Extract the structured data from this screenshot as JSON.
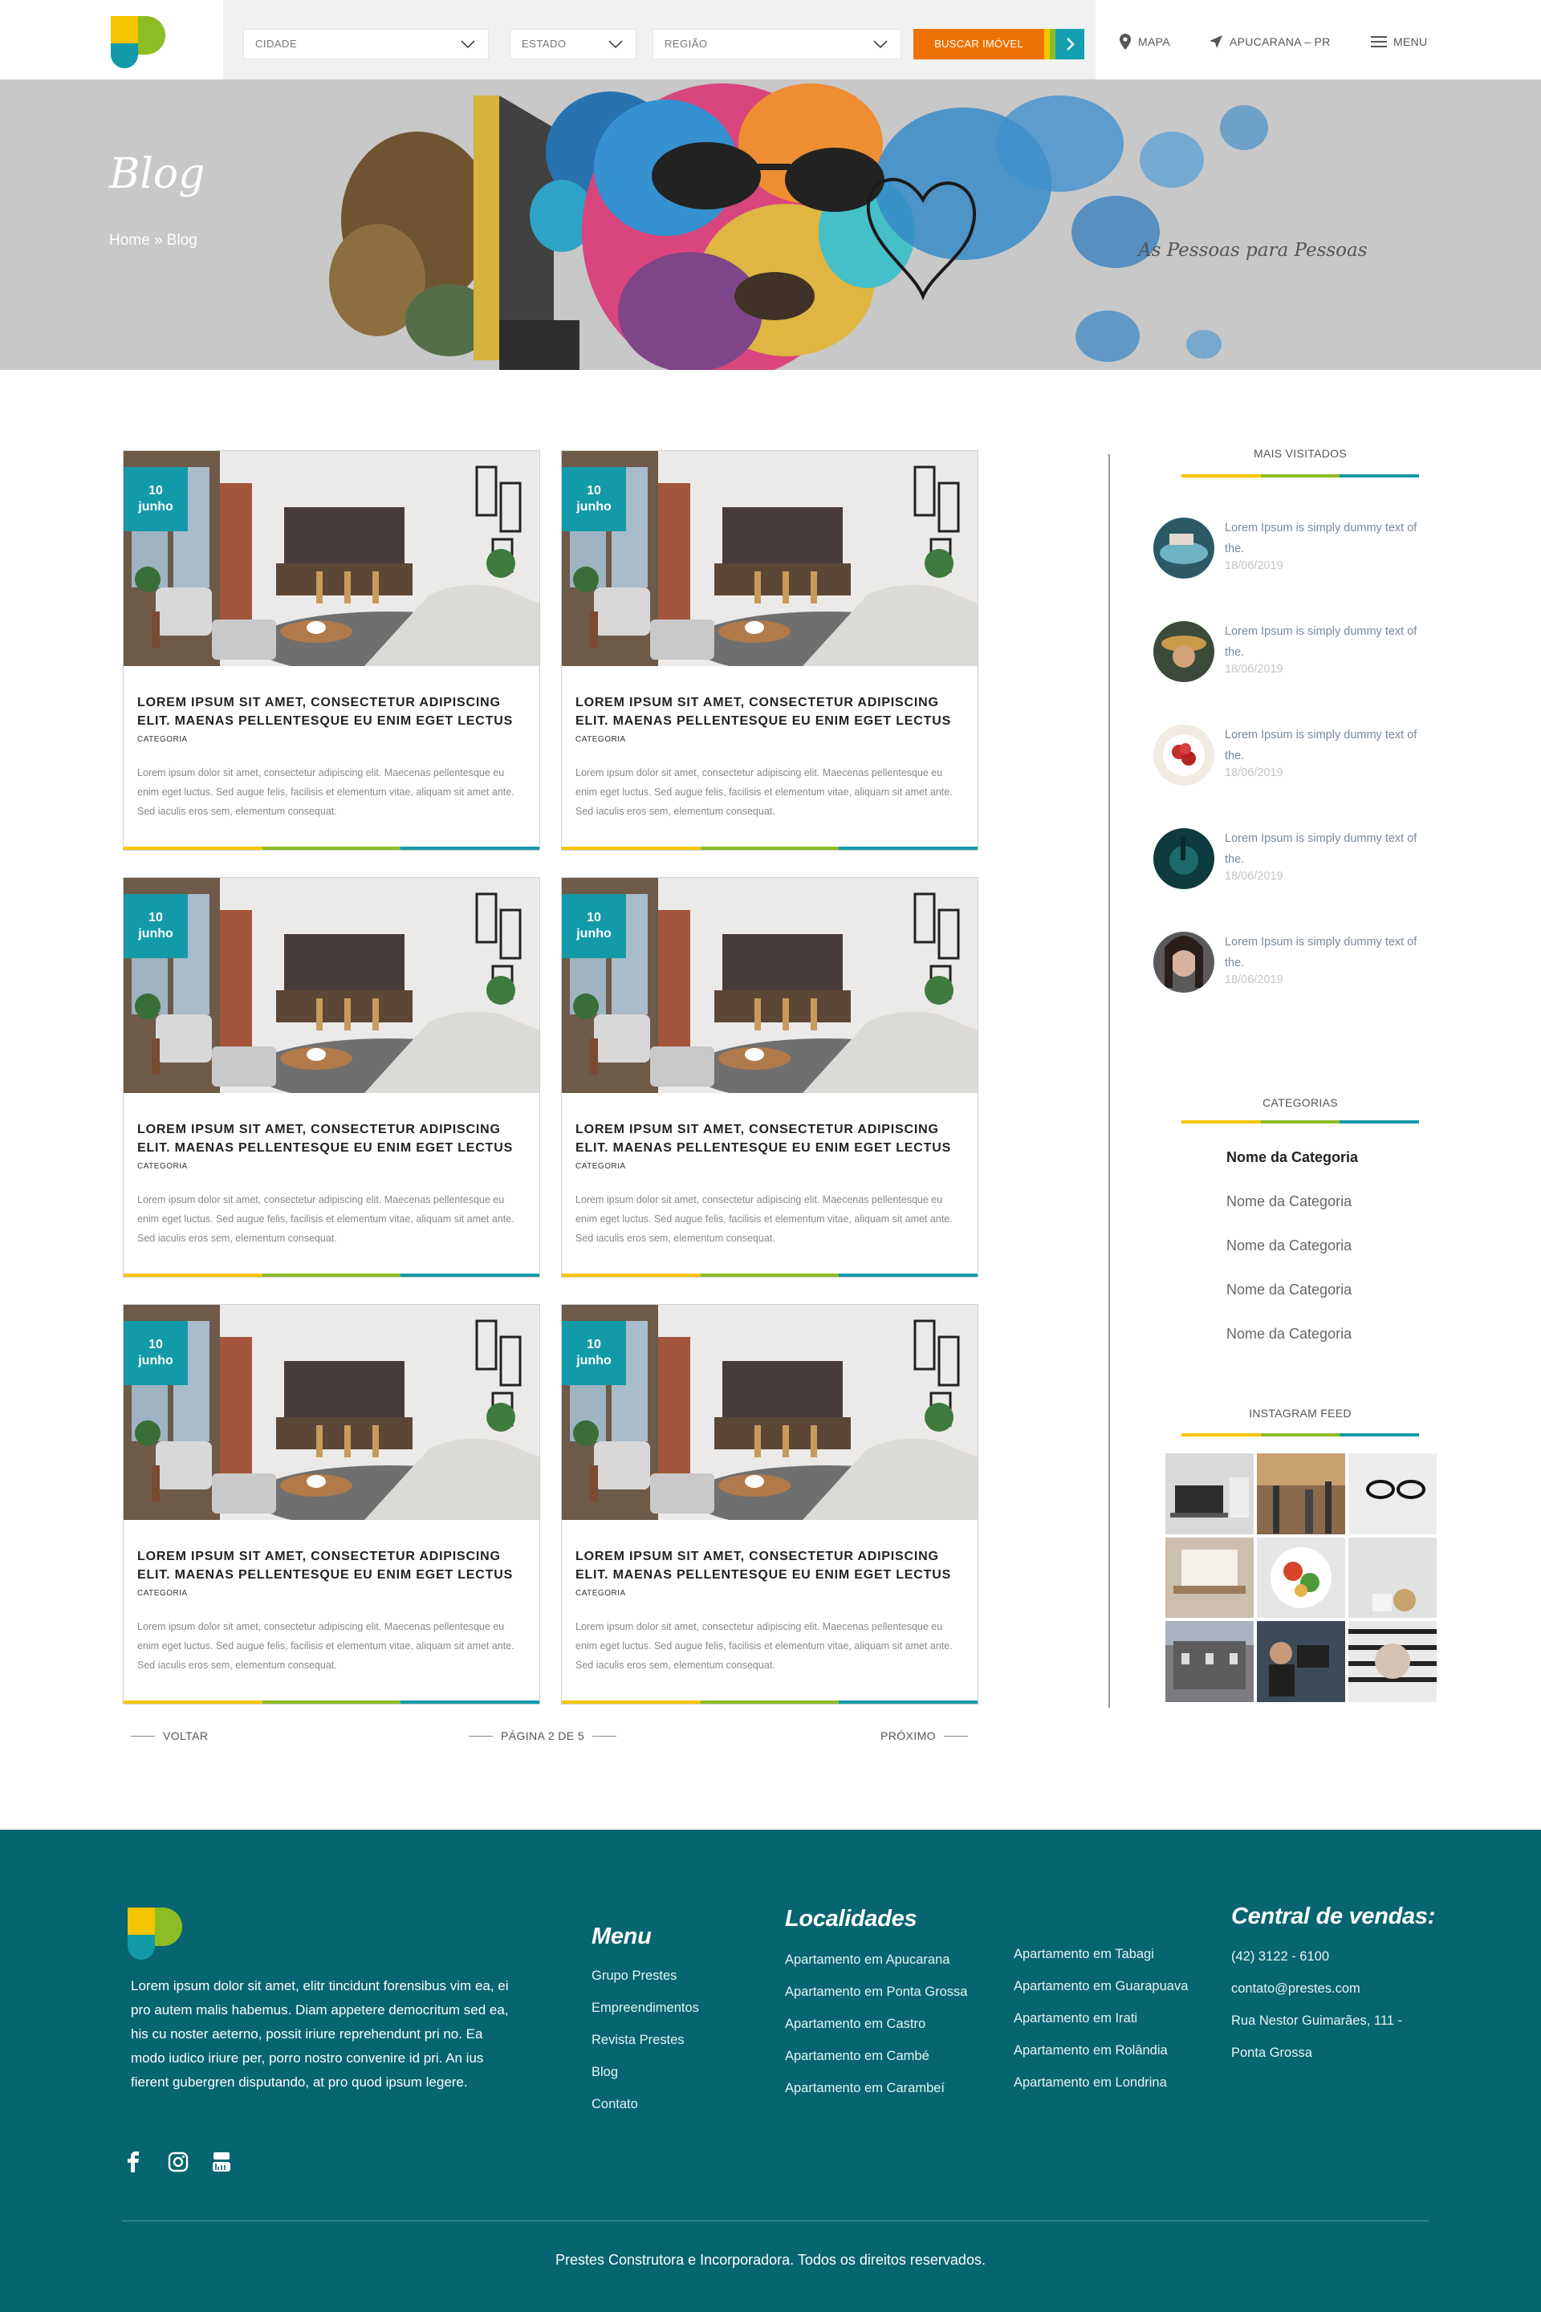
{
  "header": {
    "cidade_placeholder": "CIDADE",
    "estado_placeholder": "ESTADO",
    "regiao_placeholder": "REGIÃO",
    "buscar_label": "BUSCAR IMÓVEL",
    "mapa_label": "MAPA",
    "city_label": "APUCARANA – PR",
    "menu_label": "MENU"
  },
  "hero": {
    "title": "Blog",
    "breadcrumb": "Home » Blog",
    "signature": "As Pessoas para Pessoas"
  },
  "cards": [
    {
      "day": "10",
      "month": "junho",
      "title": "LOREM IPSUM SIT AMET, CONSECTETUR ADIPISCING ELIT. MAENAS PELLENTESQUE EU ENIM EGET LECTUS",
      "category": "CATEGORIA",
      "body": "Lorem ipsum dolor sit amet, consectetur adipiscing elit. Maecenas pellentesque eu enim eget luctus. Sed augue felis, facilisis et elementum vitae, aliquam sit amet ante. Sed iaculis eros sem, elementum consequat."
    },
    {
      "day": "10",
      "month": "junho",
      "title": "LOREM IPSUM SIT AMET, CONSECTETUR ADIPISCING ELIT. MAENAS PELLENTESQUE EU ENIM EGET LECTUS",
      "category": "CATEGORIA",
      "body": "Lorem ipsum dolor sit amet, consectetur adipiscing elit. Maecenas pellentesque eu enim eget luctus. Sed augue felis, facilisis et elementum vitae, aliquam sit amet ante. Sed iaculis eros sem, elementum consequat."
    },
    {
      "day": "10",
      "month": "junho",
      "title": "LOREM IPSUM SIT AMET, CONSECTETUR ADIPISCING ELIT. MAENAS PELLENTESQUE EU ENIM EGET LECTUS",
      "category": "CATEGORIA",
      "body": "Lorem ipsum dolor sit amet, consectetur adipiscing elit. Maecenas pellentesque eu enim eget luctus. Sed augue felis, facilisis et elementum vitae, aliquam sit amet ante. Sed iaculis eros sem, elementum consequat."
    },
    {
      "day": "10",
      "month": "junho",
      "title": "LOREM IPSUM SIT AMET, CONSECTETUR ADIPISCING ELIT. MAENAS PELLENTESQUE EU ENIM EGET LECTUS",
      "category": "CATEGORIA",
      "body": "Lorem ipsum dolor sit amet, consectetur adipiscing elit. Maecenas pellentesque eu enim eget luctus. Sed augue felis, facilisis et elementum vitae, aliquam sit amet ante. Sed iaculis eros sem, elementum consequat."
    },
    {
      "day": "10",
      "month": "junho",
      "title": "LOREM IPSUM SIT AMET, CONSECTETUR ADIPISCING ELIT. MAENAS PELLENTESQUE EU ENIM EGET LECTUS",
      "category": "CATEGORIA",
      "body": "Lorem ipsum dolor sit amet, consectetur adipiscing elit. Maecenas pellentesque eu enim eget luctus. Sed augue felis, facilisis et elementum vitae, aliquam sit amet ante. Sed iaculis eros sem, elementum consequat."
    },
    {
      "day": "10",
      "month": "junho",
      "title": "LOREM IPSUM SIT AMET, CONSECTETUR ADIPISCING ELIT. MAENAS PELLENTESQUE EU ENIM EGET LECTUS",
      "category": "CATEGORIA",
      "body": "Lorem ipsum dolor sit amet, consectetur adipiscing elit. Maecenas pellentesque eu enim eget luctus. Sed augue felis, facilisis et elementum vitae, aliquam sit amet ante. Sed iaculis eros sem, elementum consequat."
    }
  ],
  "pagination": {
    "prev": "VOLTAR",
    "page": "PÁGINA 2 DE 5",
    "next": "PRÓXIMO"
  },
  "sidebar": {
    "popular_heading": "MAIS VISITADOS",
    "popular": [
      {
        "text": "Lorem Ipsum is simply dummy text of the.",
        "date": "18/06/2019"
      },
      {
        "text": "Lorem Ipsum is simply dummy text of the.",
        "date": "18/06/2019"
      },
      {
        "text": "Lorem Ipsum is simply dummy text of the.",
        "date": "18/06/2019"
      },
      {
        "text": "Lorem Ipsum is simply dummy text of the.",
        "date": "18/06/2019"
      },
      {
        "text": "Lorem Ipsum is simply dummy text of the.",
        "date": "18/06/2019"
      }
    ],
    "categories_heading": "CATEGORIAS",
    "categories": [
      "Nome da Categoria",
      "Nome da Categoria",
      "Nome da Categoria",
      "Nome da Categoria",
      "Nome da Categoria"
    ],
    "instagram_heading": "INSTAGRAM FEED"
  },
  "footer": {
    "description": "Lorem ipsum dolor sit amet, elitr tincidunt forensibus vim ea, ei pro autem malis habemus. Diam appetere democritum sed ea, his cu noster aeterno, possit iriure reprehendunt pri no. Ea modo iudico iriure per, porro nostro convenire id pri. An ius fierent gubergren disputando, at pro quod ipsum legere.",
    "menu_heading": "Menu",
    "menu": [
      "Grupo Prestes",
      "Empreendimentos",
      "Revista Prestes",
      "Blog",
      "Contato"
    ],
    "localidades_heading": "Localidades",
    "localidades_col1": [
      "Apartamento em Apucarana",
      "Apartamento em Ponta Grossa",
      "Apartamento em Castro",
      "Apartamento em Cambé",
      "Apartamento em Carambeí"
    ],
    "localidades_col2": [
      "Apartamento em Tabagi",
      "Apartamento em Guarapuava",
      "Apartamento em Irati",
      "Apartamento em Rolândia",
      "Apartamento em Londrina"
    ],
    "central_heading": "Central de vendas:",
    "phone": "(42)  3122 - 6100",
    "email": "contato@prestes.com",
    "address_line1": "Rua Nestor Guimarães, 111 -",
    "address_line2": "Ponta Grossa",
    "copyright": "Prestes Construtora e Incorporadora. Todos os direitos reservados."
  },
  "colors": {
    "teal": "#139aa8",
    "orange": "#ee7203",
    "yellow": "#f6c400",
    "green": "#8cbd25",
    "footer_bg": "#066570"
  }
}
